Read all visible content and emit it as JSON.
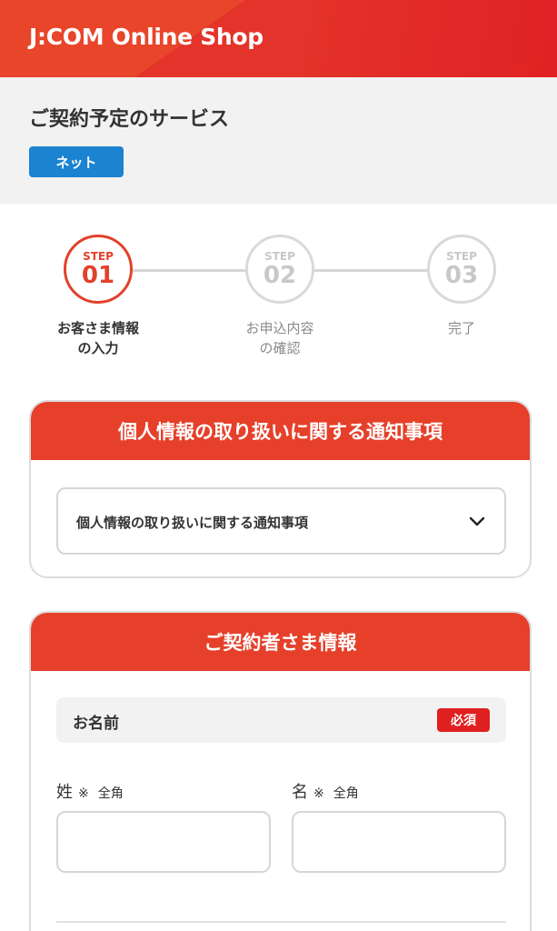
{
  "header": {
    "logo_text": "J:COM Online Shop",
    "color": "#e8452a"
  },
  "service": {
    "title": "ご契約予定のサービス",
    "badge": "ネット",
    "badge_color": "#1b83d0"
  },
  "stepper": {
    "current_step": 1,
    "steps": [
      {
        "word": "STEP",
        "number": "01",
        "label": "お客さま情報\nの入力",
        "state": "active"
      },
      {
        "word": "STEP",
        "number": "02",
        "label": "お申込内容\nの確認",
        "state": "inactive"
      },
      {
        "word": "STEP",
        "number": "03",
        "label": "完了",
        "state": "inactive"
      }
    ]
  },
  "privacy_card": {
    "title": "個人情報の取り扱いに関する通知事項",
    "accordion_label": "個人情報の取り扱いに関する通知事項",
    "accordion_icon": "chevron-down-icon"
  },
  "contract_card": {
    "title": "ご契約者さま情報",
    "name_section": {
      "label": "お名前",
      "required": "必須",
      "last_name": {
        "label": "姓",
        "mark": "※",
        "note": "全角",
        "value": ""
      },
      "first_name": {
        "label": "名",
        "mark": "※",
        "note": "全角",
        "value": ""
      }
    }
  },
  "colors": {
    "accent": "#e6402a",
    "required": "#e02020",
    "border": "#d6d6d6"
  }
}
